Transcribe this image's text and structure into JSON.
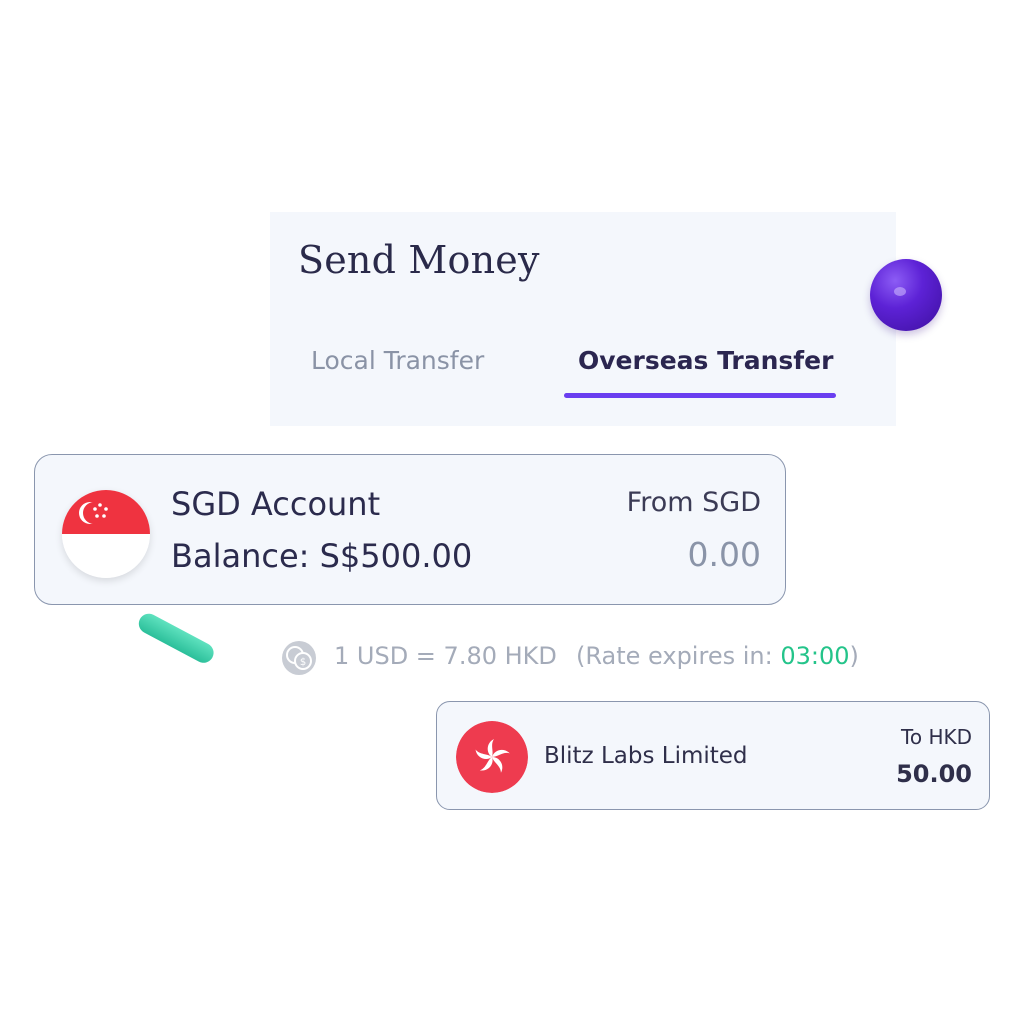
{
  "header": {
    "title": "Send Money",
    "tabs": [
      {
        "label": "Local Transfer",
        "active": false
      },
      {
        "label": "Overseas Transfer",
        "active": true
      }
    ]
  },
  "source_account": {
    "flag_icon": "singapore-flag-icon",
    "name": "SGD Account",
    "balance": "Balance: S$500.00",
    "from_label": "From SGD",
    "amount": "0.00"
  },
  "rate": {
    "icon": "currency-exchange-icon",
    "text": "1 USD = 7.80 HKD",
    "expires_prefix": "(Rate expires in: ",
    "timer": "03:00",
    "expires_suffix": ")"
  },
  "recipient": {
    "flag_icon": "hong-kong-flag-icon",
    "name": "Blitz Labs Limited",
    "to_label": "To HKD",
    "amount": "50.00"
  },
  "colors": {
    "accent": "#6a3ef0",
    "timer": "#24c48a",
    "card_bg": "#f4f7fc",
    "hk_red": "#ee3b4f",
    "sg_red": "#ef3340"
  }
}
